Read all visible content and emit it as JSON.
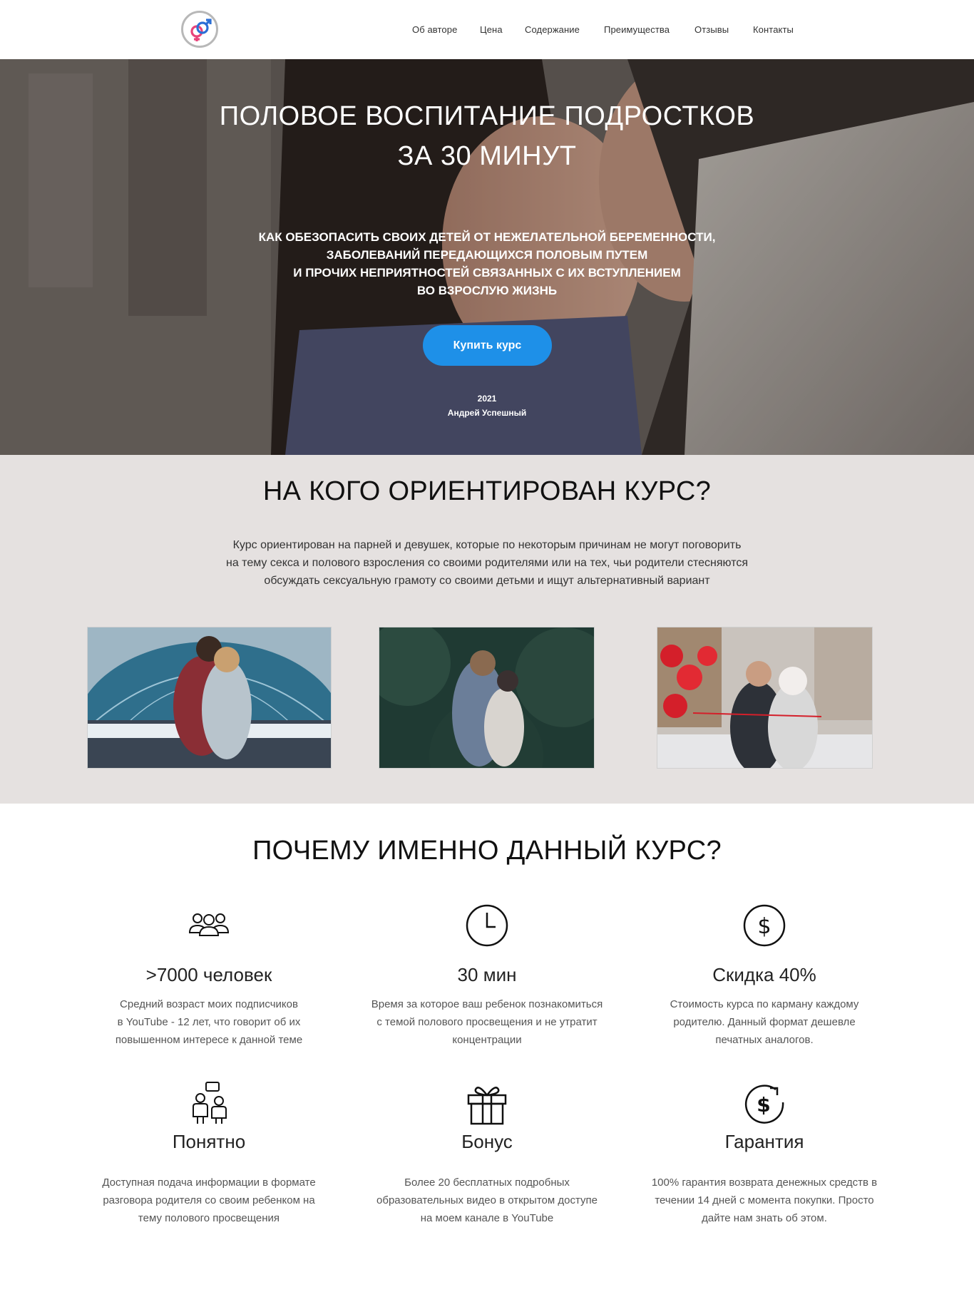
{
  "header": {
    "nav": [
      "Об авторе",
      "Цена",
      "Содержание",
      "Преимущества",
      "Отзывы",
      "Контакты"
    ]
  },
  "hero": {
    "title_line1": "ПОЛОВОЕ ВОСПИТАНИЕ ПОДРОСТКОВ",
    "title_line2": "ЗА 30 МИНУТ",
    "subtitle_lines": [
      "КАК ОБЕЗОПАСИТЬ СВОИХ ДЕТЕЙ ОТ НЕЖЕЛАТЕЛЬНОЙ БЕРЕМЕННОСТИ,",
      "ЗАБОЛЕВАНИЙ ПЕРЕДАЮЩИХСЯ ПОЛОВЫМ ПУТЕМ",
      "И ПРОЧИХ НЕПРИЯТНОСТЕЙ СВЯЗАННЫХ С ИХ ВСТУПЛЕНИЕМ",
      "ВО ВЗРОСЛУЮ ЖИЗНЬ"
    ],
    "buy_label": "Купить курс",
    "year": "2021",
    "author": "Андрей Успешный"
  },
  "audience": {
    "title": "НА КОГО ОРИЕНТИРОВАН КУРС?",
    "text_lines": [
      "Курс ориентирован на парней и девушек, которые по некоторым причинам не могут поговорить",
      "на тему секса и полового взросления со своими родителями или на тех, чьи родители стесняются",
      "обсуждать сексуальную грамоту со своими детьми и ищут альтернативный вариант"
    ]
  },
  "features": {
    "title": "ПОЧЕМУ ИМЕННО ДАННЫЙ КУРС?",
    "items": [
      {
        "icon": "people-icon",
        "title": ">7000 человек",
        "lines": [
          "Средний возраст моих подписчиков",
          "в YouTube - 12 лет, что говорит об их",
          "повышенном интересе к данной теме"
        ]
      },
      {
        "icon": "clock-icon",
        "title": "30 мин",
        "lines": [
          "Время за которое ваш ребенок познакомиться",
          "с темой полового просвещения и не утратит",
          "концентрации"
        ]
      },
      {
        "icon": "dollar-icon",
        "title": "Скидка 40%",
        "lines": [
          "Стоимость курса по карману каждому",
          "родителю. Данный формат дешевле",
          "печатных аналогов."
        ]
      },
      {
        "icon": "conversation-icon",
        "title": "Понятно",
        "lines": [
          "Доступная подача информации в формате",
          "разговора родителя со своим ребенком на",
          "тему полового просвещения"
        ]
      },
      {
        "icon": "gift-icon",
        "title": "Бонус",
        "lines": [
          "Более 20 бесплатных подробных",
          "образовательных видео в открытом доступе",
          "на моем канале в YouTube"
        ]
      },
      {
        "icon": "refund-icon",
        "title": "Гарантия",
        "lines": [
          "100% гарантия возврата денежных средств в",
          "течении 14 дней с момента покупки. Просто",
          "дайте нам знать об этом."
        ]
      }
    ]
  },
  "colors": {
    "accent": "#1e90e8",
    "section_bg": "#e5e1e0",
    "logo_pink": "#e8437a",
    "logo_blue": "#2a6fd6"
  }
}
